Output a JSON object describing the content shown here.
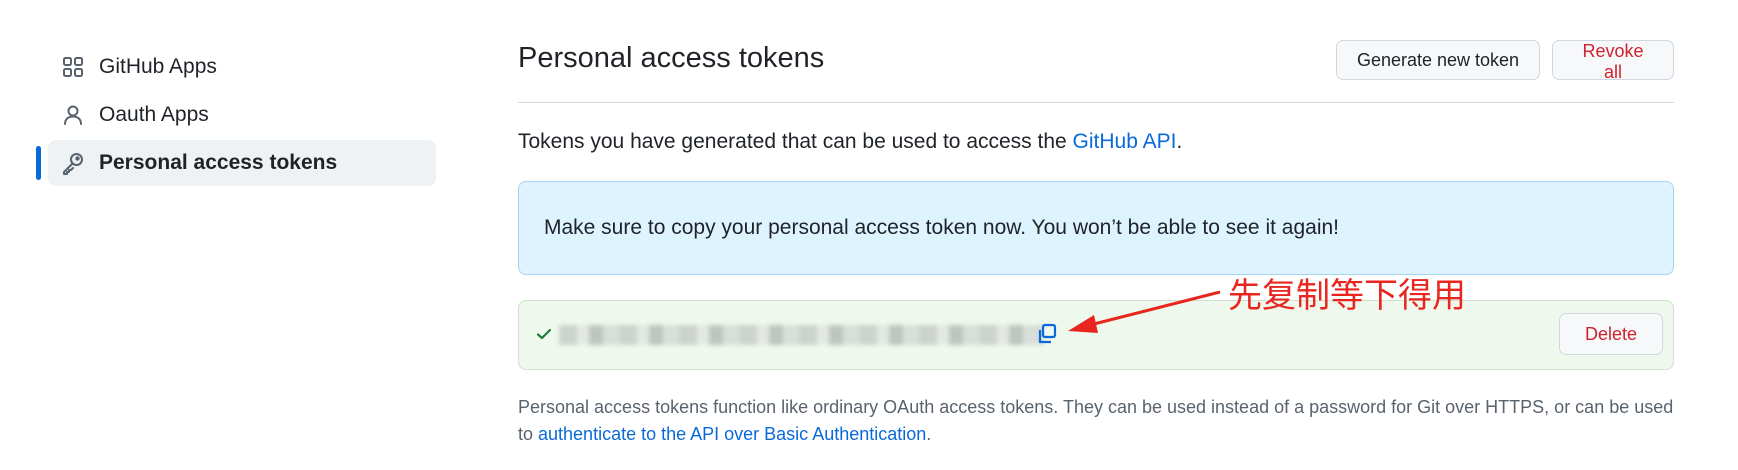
{
  "sidebar": {
    "items": [
      {
        "label": "GitHub Apps",
        "icon": "apps-grid-icon"
      },
      {
        "label": "Oauth Apps",
        "icon": "person-icon"
      },
      {
        "label": "Personal access tokens",
        "icon": "key-icon",
        "active": true
      }
    ]
  },
  "main": {
    "title": "Personal access tokens",
    "generate_button": "Generate new token",
    "revoke_button": "Revoke all",
    "intro_text": "Tokens you have generated that can be used to access the ",
    "intro_link": "GitHub API",
    "intro_end": ".",
    "flash_message": "Make sure to copy your personal access token now. You won’t be able to see it again!",
    "token": {
      "value_obscured": true,
      "delete_button": "Delete"
    },
    "note_text": "Personal access tokens function like ordinary OAuth access tokens. They can be used instead of a password for Git over HTTPS, or can be used to ",
    "note_link": "authenticate to the API over Basic Authentication",
    "note_end": "."
  },
  "annotation": {
    "text": "先复制等下得用",
    "color": "#e8261f"
  },
  "colors": {
    "accent": "#0969da",
    "danger": "#cf222e",
    "flash_bg": "#ddf4ff",
    "token_bg": "#eef8ec"
  }
}
